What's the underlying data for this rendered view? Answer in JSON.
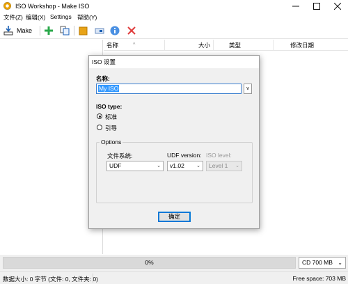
{
  "window": {
    "title": "ISO Workshop - Make ISO"
  },
  "menu": [
    "文件(Z)",
    "编辑(X)",
    "Settings",
    "帮助(Y)"
  ],
  "toolbar": {
    "make_label": "Make"
  },
  "list": {
    "columns": [
      "名称",
      "大小",
      "类型",
      "修改日期"
    ]
  },
  "progress": {
    "text": "0%",
    "value": 0
  },
  "capacity": {
    "selected": "CD 700 MB"
  },
  "status": {
    "left": "数据大小: 0 字节 (文件: 0, 文件夹: 0)",
    "right": "Free space: 703 MB"
  },
  "dialog": {
    "title": "ISO 设置",
    "name_label": "名称:",
    "name_value": "My ISO",
    "v_button": "v",
    "iso_type_label": "ISO type:",
    "iso_types": [
      "标准",
      "引导"
    ],
    "iso_type_selected": "标准",
    "options_legend": "Options",
    "fs_label": "文件系统:",
    "fs_value": "UDF",
    "udf_version_label": "UDF version:",
    "udf_version_value": "v1.02",
    "iso_level_label": "ISO level:",
    "iso_level_value": "Level 1",
    "ok_label": "确定"
  },
  "colors": {
    "accent": "#0078d7",
    "selection": "#3399ff",
    "add_green": "#2aa84a",
    "delete_red": "#e03c3c",
    "info_blue": "#4a90e2",
    "folder_orange": "#e8a317"
  }
}
